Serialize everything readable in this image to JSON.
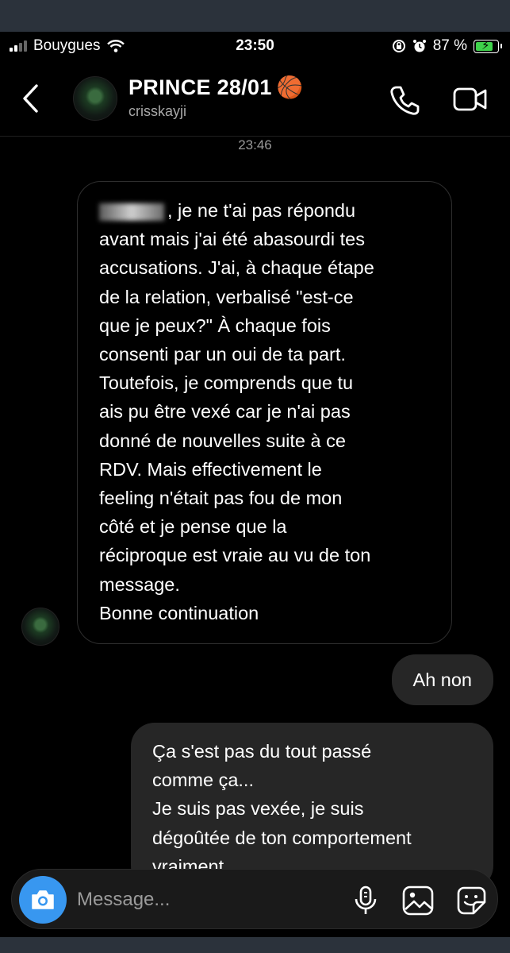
{
  "status_bar": {
    "carrier": "Bouygues",
    "time": "23:50",
    "battery_percent": "87 %",
    "battery_level": 0.87,
    "icons": [
      "signal-icon",
      "wifi-icon",
      "orientation-lock-icon",
      "alarm-icon",
      "battery-charging-icon"
    ]
  },
  "header": {
    "title": "PRINCE 28/01",
    "title_emoji": "🏀",
    "username": "crisskayji"
  },
  "conversation": {
    "timestamp": "23:46",
    "incoming": {
      "redacted_prefix": "N",
      "lines": [
        ", je ne t'ai pas répondu",
        "avant mais j'ai été abasourdi tes",
        "accusations. J'ai, à chaque étape",
        "de la relation, verbalisé \"est-ce",
        "que je peux?\" À chaque fois",
        "consenti par un oui de ta part.",
        "Toutefois, je comprends que tu",
        "ais pu être vexé car je n'ai pas",
        "donné de nouvelles suite à ce",
        "RDV. Mais effectivement le",
        "feeling n'était pas fou de mon",
        "côté et je pense que la",
        "réciproque est vraie au vu de ton",
        "message.",
        "Bonne continuation"
      ]
    },
    "outgoing_short": "Ah non",
    "outgoing_long": {
      "lines": [
        "Ça s'est pas du tout passé",
        "comme ça...",
        "Je suis pas vexée, je suis",
        "dégoûtée de ton comportement",
        "vraiment"
      ]
    }
  },
  "composer": {
    "placeholder": "Message..."
  },
  "colors": {
    "background": "#000000",
    "outgoing_bubble": "#262626",
    "camera_button": "#3897f0",
    "battery_fill": "#3fd24b"
  }
}
